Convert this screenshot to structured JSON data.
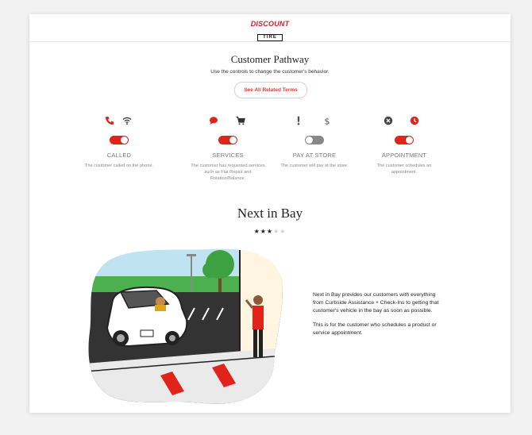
{
  "header": {
    "logo_line1": "DISCOUNT",
    "logo_line2": "TIRE"
  },
  "pathway": {
    "title": "Customer Pathway",
    "subtitle": "Use the controls to change the customer's behavior.",
    "terms_button": "See All Related Terms",
    "options": [
      {
        "label": "CALLED",
        "description": "The customer called on the phone.",
        "enabled": true,
        "icons": [
          "phone-icon",
          "wifi-icon"
        ]
      },
      {
        "label": "SERVICES",
        "description": "The customer has requested services such as Flat Repair and Rotation/Balance.",
        "enabled": true,
        "icons": [
          "chat-bubble-icon",
          "cart-icon"
        ]
      },
      {
        "label": "PAY AT STORE",
        "description": "The customer will pay at the store.",
        "enabled": false,
        "icons": [
          "exclamation-icon",
          "dollar-icon"
        ]
      },
      {
        "label": "APPOINTMENT",
        "description": "The customer schedules an appointment.",
        "enabled": true,
        "icons": [
          "close-circle-icon",
          "clock-icon"
        ]
      }
    ]
  },
  "next_in_bay": {
    "title": "Next in Bay",
    "rating": 3,
    "rating_max": 5,
    "paragraph1": "Next in Bay provides our customers with everything from Curbside Assistance + Check-Ins to getting that customer's vehicle in the bay as soon as possible.",
    "paragraph2": "This is for the customer who schedules a product or service appointment."
  },
  "colors": {
    "accent_red": "#e2231a",
    "toggle_off": "#888888"
  }
}
